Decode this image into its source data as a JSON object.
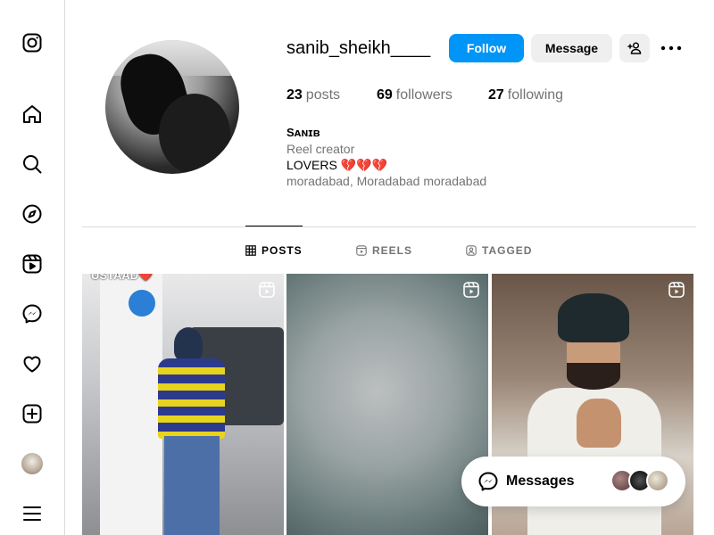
{
  "nav": {
    "items": [
      {
        "name": "instagram-logo-icon"
      },
      {
        "name": "home-icon"
      },
      {
        "name": "search-icon"
      },
      {
        "name": "explore-icon"
      },
      {
        "name": "reels-icon"
      },
      {
        "name": "messenger-icon"
      },
      {
        "name": "notifications-heart-icon"
      },
      {
        "name": "create-plus-icon"
      },
      {
        "name": "profile-avatar"
      },
      {
        "name": "more-menu-icon"
      }
    ]
  },
  "profile": {
    "username": "sanib_sheikh____",
    "follow_label": "Follow",
    "message_label": "Message",
    "stats": {
      "posts_count": "23",
      "posts_label": "posts",
      "followers_count": "69",
      "followers_label": "followers",
      "following_count": "27",
      "following_label": "following"
    },
    "bio": {
      "name": "Sᴀɴɪʙ",
      "category": "Reel creator",
      "line": "LOVERS 💔💔💔",
      "location": "moradabad, Moradabad moradabad"
    }
  },
  "tabs": [
    {
      "label": "POSTS",
      "active": true
    },
    {
      "label": "REELS",
      "active": false
    },
    {
      "label": "TAGGED",
      "active": false
    }
  ],
  "posts": [
    {
      "type": "reel",
      "overlay_text": "USTAAD❤️"
    },
    {
      "type": "reel"
    },
    {
      "type": "reel"
    }
  ],
  "messages": {
    "label": "Messages"
  },
  "colors": {
    "accent": "#0095f6",
    "secondary_button": "#efefef",
    "muted_text": "#737373",
    "border": "#dbdbdb"
  }
}
